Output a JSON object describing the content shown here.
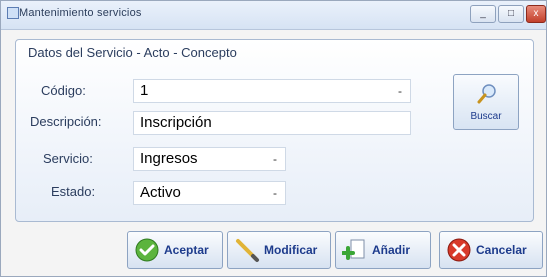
{
  "window": {
    "title": "Mantenimiento servicios",
    "min_glyph": "_",
    "max_glyph": "□",
    "close_glyph": "x"
  },
  "form": {
    "group_title": "Datos del Servicio - Acto - Concepto",
    "codigo": {
      "label": "Código:",
      "value": "1"
    },
    "descripcion": {
      "label": "Descripción:",
      "value": "Inscripción"
    },
    "servicio": {
      "label": "Servicio:",
      "value": "Ingresos"
    },
    "estado": {
      "label": "Estado:",
      "value": "Activo"
    },
    "dropdown_glyph": "-"
  },
  "buscar": {
    "label": "Buscar"
  },
  "actions": {
    "aceptar": "Aceptar",
    "modificar": "Modificar",
    "anadir": "Añadir",
    "cancelar": "Cancelar"
  }
}
